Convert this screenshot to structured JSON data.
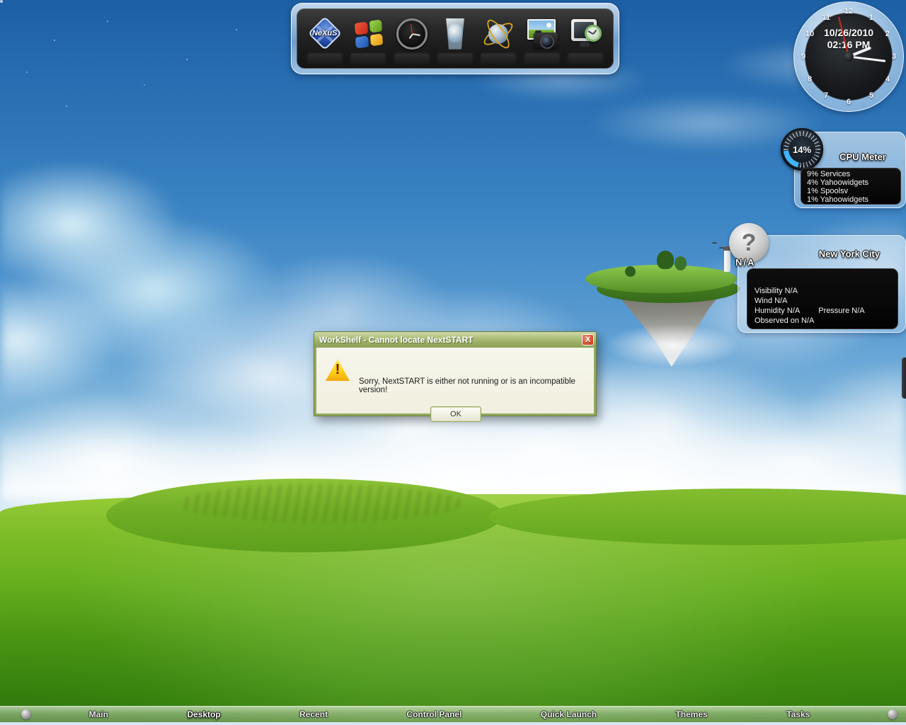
{
  "dock": {
    "icons": [
      {
        "name": "nexus",
        "label": "NeXuS"
      },
      {
        "name": "windows"
      },
      {
        "name": "clock"
      },
      {
        "name": "recycle-bin"
      },
      {
        "name": "globe-orbit"
      },
      {
        "name": "photo-camera"
      },
      {
        "name": "monitor-clock"
      }
    ]
  },
  "clock_widget": {
    "date": "10/26/2010",
    "time": "02:16 PM",
    "numbers": [
      "1",
      "2",
      "3",
      "4",
      "5",
      "6",
      "7",
      "8",
      "9",
      "10",
      "11",
      "12"
    ]
  },
  "cpu_widget": {
    "title": "CPU Meter",
    "value": "14%",
    "processes": [
      "9% Services",
      "4% Yahoowidgets",
      "1% Spoolsv",
      "1% Yahoowidgets"
    ]
  },
  "weather_widget": {
    "city": "New York City",
    "condition": "N/A",
    "question_glyph": "?",
    "visibility": "Visibility N/A",
    "wind": "Wind N/A",
    "humidity": "Humidity N/A",
    "pressure": "Pressure N/A",
    "observed": "Observed on N/A"
  },
  "dialog": {
    "title": "WorkShelf - Cannot locate NextSTART",
    "close_glyph": "X",
    "warning_glyph": "!",
    "message": "Sorry, NextSTART is either not running or is an incompatible version!",
    "ok": "OK"
  },
  "taskbar": {
    "items": [
      "Main",
      "Desktop",
      "Recent",
      "Control Panel",
      "Quick Launch",
      "Themes",
      "Tasks"
    ],
    "active_item": "Desktop"
  },
  "colors": {
    "dialog_titlebar": "#a9bc78",
    "dialog_body": "#f2f0e1",
    "widget_box": "#060606",
    "gauge_accent": "#3fb4ff",
    "sky_top": "#1d5fa5",
    "grass": "#66af1e"
  }
}
